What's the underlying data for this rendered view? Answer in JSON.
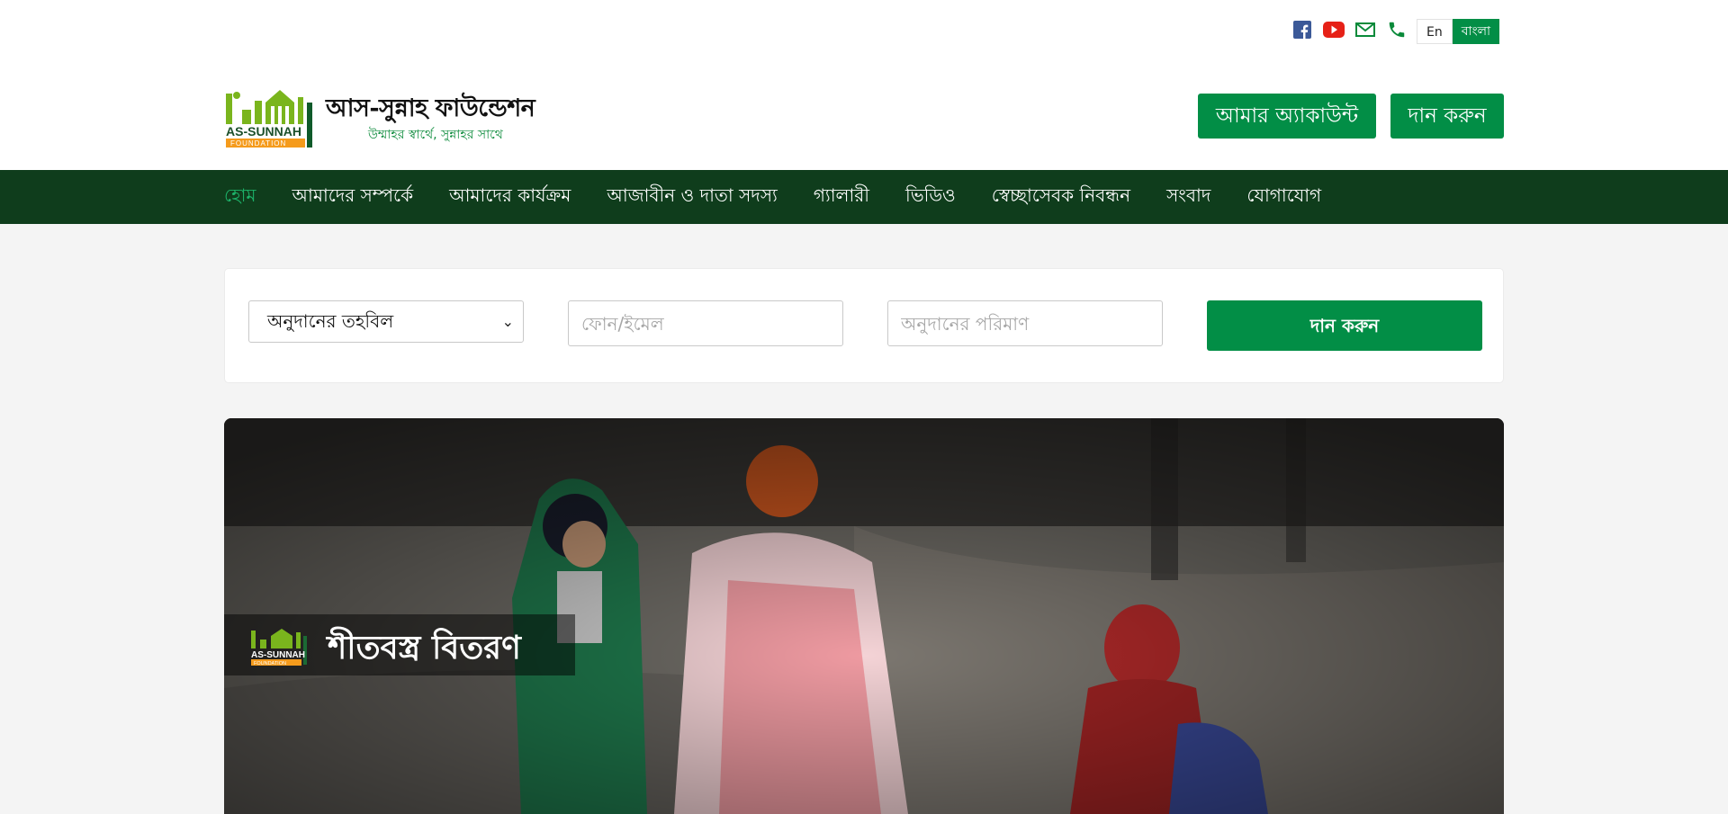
{
  "topbar": {
    "social_icons": [
      "facebook-icon",
      "youtube-icon",
      "mail-icon",
      "phone-icon"
    ],
    "lang_en": "En",
    "lang_bn": "বাংলা"
  },
  "header": {
    "logo_text_en": "AS-SUNNAH",
    "logo_subtext_en": "FOUNDATION",
    "logo_name": "আস-সুন্নাহ ফাউন্ডেশন",
    "logo_tagline": "উম্মাহর স্বার্থে, সুন্নাহর সাথে",
    "account_button": "আমার অ্যাকাউন্ট",
    "donate_button": "দান করুন"
  },
  "nav": {
    "items": [
      {
        "label": "হোম",
        "active": true
      },
      {
        "label": "আমাদের সম্পর্কে"
      },
      {
        "label": "আমাদের কার্যক্রম"
      },
      {
        "label": "আজাবীন ও দাতা সদস্য"
      },
      {
        "label": "গ্যালারী"
      },
      {
        "label": "ভিডিও"
      },
      {
        "label": "স্বেচ্ছাসেবক নিবন্ধন"
      },
      {
        "label": "সংবাদ"
      },
      {
        "label": "যোগাযোগ"
      }
    ]
  },
  "donation_form": {
    "fund_select_value": "অনুদানের তহবিল",
    "phone_placeholder": "ফোন/ইমেল",
    "amount_placeholder": "অনুদানের পরিমাণ",
    "submit_label": "দান করুন"
  },
  "hero": {
    "badge_title": "শীতবস্ত্র বিতরণ",
    "badge_logo_text": "AS-SUNNAH",
    "badge_logo_subtext": "FOUNDATION"
  },
  "colors": {
    "brand_green": "#028e46",
    "nav_bg": "#0f3d1c",
    "nav_active": "#1db36a",
    "page_bg": "#f4f4f4"
  }
}
